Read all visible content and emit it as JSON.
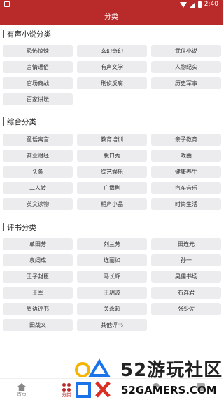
{
  "status": {
    "time": "2:40"
  },
  "header": {
    "title": "分类"
  },
  "sections": [
    {
      "title": "有声小说分类",
      "items": [
        "恐怖惊悚",
        "玄幻奇幻",
        "武侠小说",
        "言情通俗",
        "有声文学",
        "人物纪实",
        "官场商战",
        "刑侦反腐",
        "历史军事",
        "百家讲坛"
      ]
    },
    {
      "title": "综合分类",
      "items": [
        "童话寓言",
        "教育培训",
        "亲子教育",
        "商业财经",
        "脱口秀",
        "戏曲",
        "头条",
        "综艺娱乐",
        "健康养生",
        "二人转",
        "广播剧",
        "汽车音乐",
        "英文读物",
        "相声小品",
        "时尚生活"
      ]
    },
    {
      "title": "评书分类",
      "items": [
        "单田芳",
        "刘兰芳",
        "田连元",
        "袁阔成",
        "连丽如",
        "孙一",
        "王子封臣",
        "马长辉",
        "昊儒书场",
        "王军",
        "王玥波",
        "石连君",
        "粤语评书",
        "关永超",
        "张少佐",
        "田战义",
        "其他评书"
      ]
    }
  ],
  "nav": [
    {
      "label": "首页",
      "icon": "home-icon"
    },
    {
      "label": "分类",
      "icon": "category-icon"
    },
    {
      "label": "",
      "icon": "download-icon"
    },
    {
      "label": "",
      "icon": "user-icon"
    },
    {
      "label": "",
      "icon": "camera-icon"
    }
  ],
  "watermark": {
    "big": "52游玩社区",
    "small": "52GAMERS.COM"
  },
  "colors": {
    "brand": "#b92a2a",
    "tag_bg": "#ececef"
  }
}
